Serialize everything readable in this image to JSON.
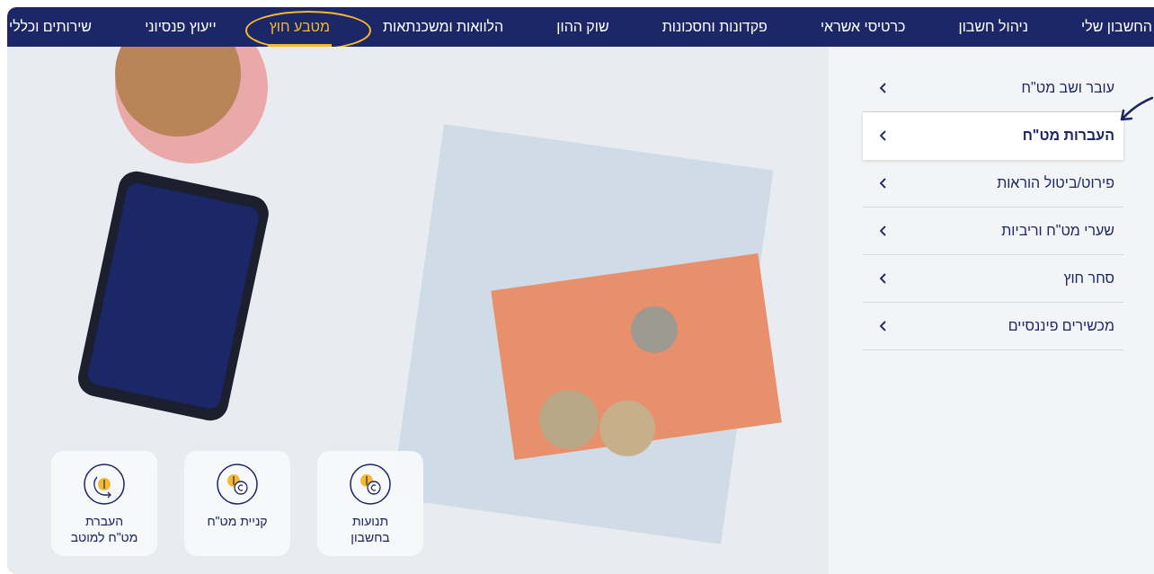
{
  "nav": {
    "items": [
      {
        "label": "החשבון שלי",
        "selected": false
      },
      {
        "label": "ניהול חשבון",
        "selected": false
      },
      {
        "label": "כרטיסי אשראי",
        "selected": false
      },
      {
        "label": "פקדונות וחסכונות",
        "selected": false
      },
      {
        "label": "שוק ההון",
        "selected": false
      },
      {
        "label": "הלוואות ומשכנתאות",
        "selected": false
      },
      {
        "label": "מטבע חוץ",
        "selected": true
      },
      {
        "label": "ייעוץ פנסיוני",
        "selected": false
      },
      {
        "label": "שירותים וכללי",
        "selected": false
      }
    ]
  },
  "side_menu": {
    "items": [
      {
        "label": "עובר ושב מט\"ח",
        "selected": false
      },
      {
        "label": "העברות מט\"ח",
        "selected": true
      },
      {
        "label": "פירוט/ביטול הוראות",
        "selected": false
      },
      {
        "label": "שערי מט\"ח וריביות",
        "selected": false
      },
      {
        "label": "סחר חוץ",
        "selected": false
      },
      {
        "label": "מכשירים פיננסיים",
        "selected": false
      }
    ]
  },
  "quick_actions": [
    {
      "label": "תנועות\nבחשבון",
      "kind": "coins"
    },
    {
      "label": "קניית מט\"ח",
      "kind": "coins"
    },
    {
      "label": "העברת\nמט\"ח למוטב",
      "kind": "transfer"
    }
  ]
}
